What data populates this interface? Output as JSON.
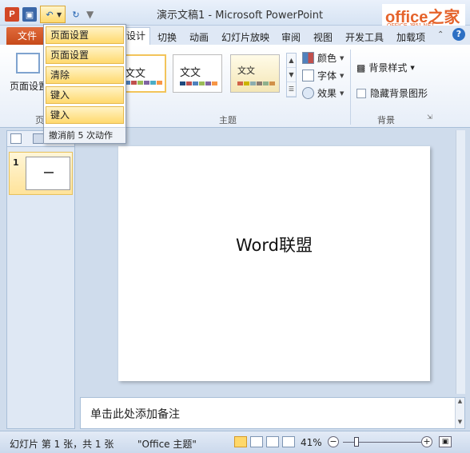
{
  "window": {
    "title": "演示文稿1 - Microsoft PowerPoint",
    "brand_main": "office之家",
    "brand_sub": "OFFICE.JB51.NET"
  },
  "qat": {
    "app_icon": "ppt-logo-icon",
    "icons": [
      "save-icon",
      "undo-icon",
      "redo-icon",
      "customize-icon"
    ]
  },
  "tabs": {
    "file": "文件",
    "design": "设计",
    "items": [
      "切换",
      "动画",
      "幻灯片放映",
      "审阅",
      "视图",
      "开发工具",
      "加载项"
    ]
  },
  "undo_menu": {
    "items": [
      "页面设置",
      "页面设置",
      "清除",
      "键入",
      "键入"
    ],
    "footer": "撤消前 5 次动作"
  },
  "ribbon": {
    "page_setup_label": "页面设置",
    "page_setup_group_partial": "页",
    "themes_group": "主题",
    "theme_sample_text": "文文",
    "theme_sample_text_3": "文文",
    "colors": "颜色",
    "fonts": "字体",
    "effects": "效果",
    "bg_styles": "背景样式",
    "hide_bg": "隐藏背景图形",
    "bg_group": "背景"
  },
  "slide_pane": {
    "slide_number": "1"
  },
  "slide": {
    "title_text": "Word联盟"
  },
  "notes": {
    "placeholder": "单击此处添加备注"
  },
  "status": {
    "slide_info": "幻灯片 第 1 张，共 1 张",
    "theme_name": "\"Office 主题\"",
    "zoom": "41%"
  },
  "zoom_level": 0.41
}
